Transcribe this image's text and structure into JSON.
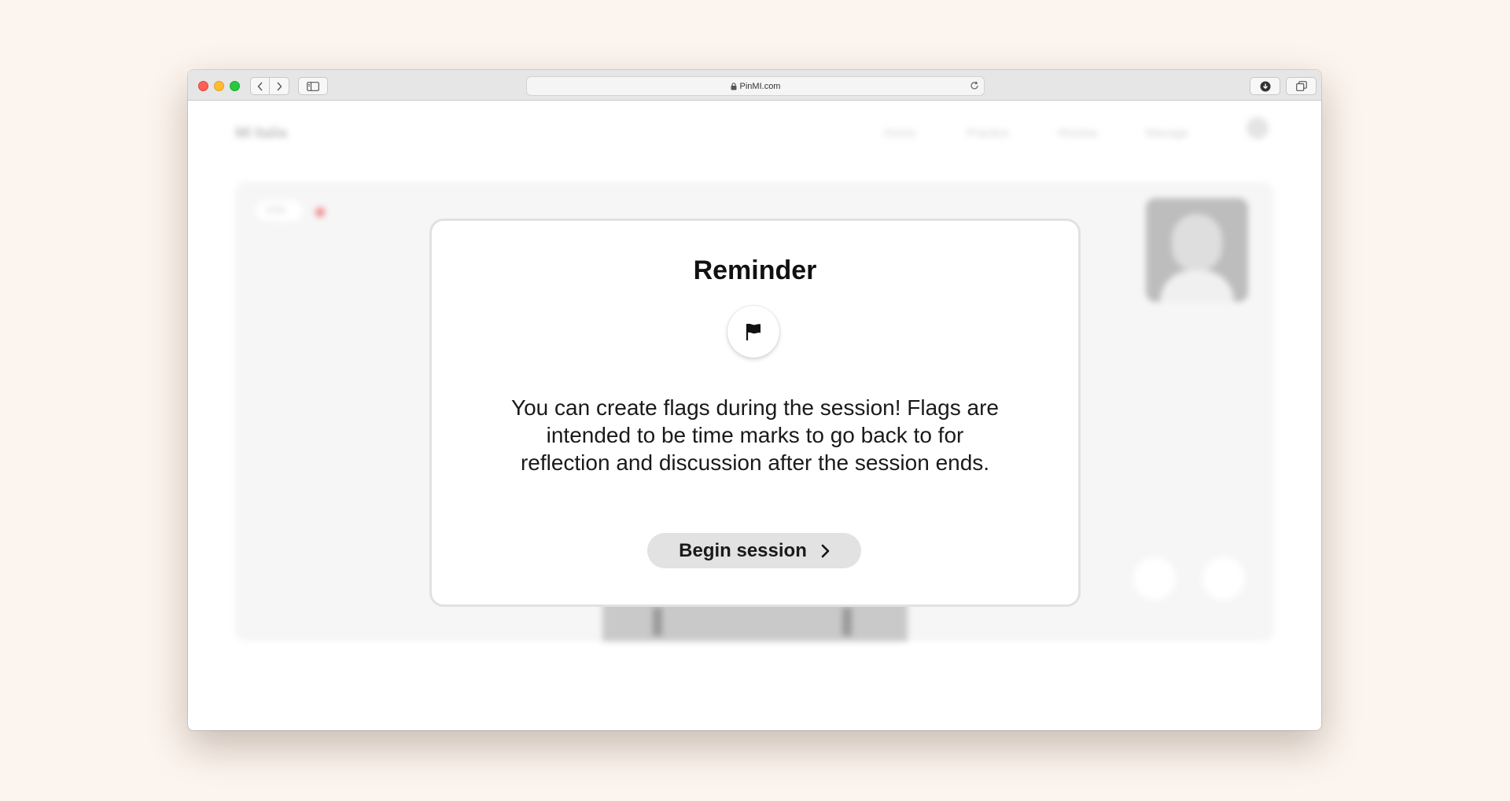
{
  "browser": {
    "url": "PinMI.com"
  },
  "background_page": {
    "logo": "MI Italia",
    "nav": [
      "Home",
      "Practice",
      "Review",
      "Manage"
    ],
    "timer": "0:00"
  },
  "modal": {
    "title": "Reminder",
    "icon": "flag-icon",
    "message": "You can create flags during the session! Flags are intended to be time marks to go back to for reflection and discussion after the session ends.",
    "button_label": "Begin session"
  },
  "colors": {
    "background": "#fcf4ee",
    "button_bg": "#e2e2e2",
    "modal_border": "#e1e1e1"
  }
}
